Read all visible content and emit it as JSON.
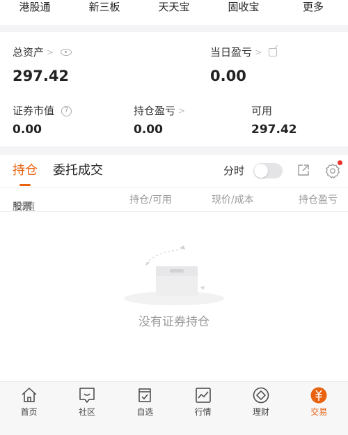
{
  "top_nav": {
    "items": [
      {
        "label": "港股通"
      },
      {
        "label": "新三板"
      },
      {
        "label": "天天宝"
      },
      {
        "label": "固收宝"
      },
      {
        "label": "更多"
      }
    ]
  },
  "assets": {
    "total_label": "总资产",
    "total_value": "297.42",
    "daily_pnl_label": "当日盈亏",
    "daily_pnl_value": "0.00",
    "market_value_label": "证券市值",
    "market_value": "0.00",
    "position_pnl_label": "持仓盈亏",
    "position_pnl_value": "0.00",
    "available_label": "可用",
    "available_value": "297.42",
    "chevron": ">"
  },
  "holdings": {
    "tabs": [
      {
        "label": "持仓",
        "active": true
      },
      {
        "label": "委托成交",
        "active": false
      }
    ],
    "fenshi_label": "分时",
    "fenshi_on": false,
    "columns": {
      "stock": "股票",
      "stock_sep": "/市值",
      "position": "持仓/可用",
      "price": "现价/成本",
      "pnl": "持仓盈亏"
    },
    "empty_text": "没有证券持仓"
  },
  "bottom_nav": {
    "items": [
      {
        "label": "首页",
        "icon": "home-icon"
      },
      {
        "label": "社区",
        "icon": "community-icon"
      },
      {
        "label": "自选",
        "icon": "watchlist-icon"
      },
      {
        "label": "行情",
        "icon": "market-icon"
      },
      {
        "label": "理财",
        "icon": "wealth-icon"
      },
      {
        "label": "交易",
        "icon": "trade-icon",
        "active": true
      }
    ]
  },
  "colors": {
    "accent": "#e8620f",
    "badge": "#e8322b",
    "muted": "#999999"
  }
}
